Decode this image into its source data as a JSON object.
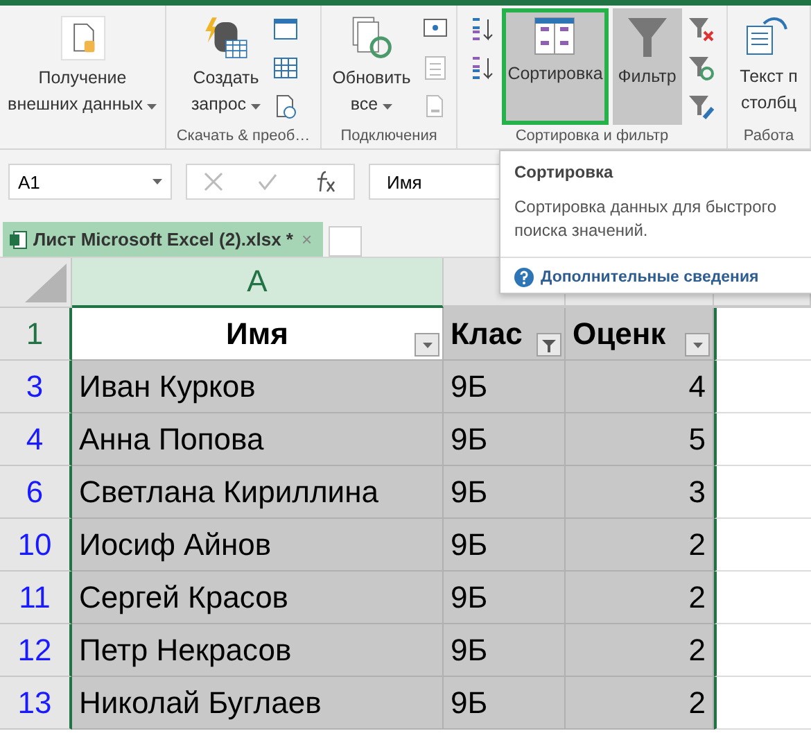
{
  "ribbon": {
    "groups": [
      {
        "buttons": [
          {
            "lines": [
              "Получение",
              "внешних данных"
            ],
            "has_menu": true,
            "selected": false,
            "pressed": false
          }
        ]
      },
      {
        "label": "Скачать & преоб…",
        "buttons": [
          {
            "lines": [
              "Создать",
              "запрос"
            ],
            "has_menu": true,
            "selected": false,
            "pressed": false
          }
        ]
      },
      {
        "label": "Подключения",
        "buttons": [
          {
            "lines": [
              "Обновить",
              "все"
            ],
            "has_menu": true,
            "selected": false,
            "pressed": false
          }
        ]
      },
      {
        "label": "Сортировка и фильтр",
        "buttons": [
          {
            "lines": [
              "Сортировка"
            ],
            "has_menu": false,
            "selected": true,
            "pressed": true
          },
          {
            "lines": [
              "Фильтр"
            ],
            "has_menu": false,
            "selected": false,
            "pressed": true
          }
        ]
      },
      {
        "label": "Работа",
        "buttons": [
          {
            "lines": [
              "Текст п",
              "столбц"
            ],
            "has_menu": false,
            "selected": false,
            "pressed": false
          }
        ]
      }
    ]
  },
  "formula_bar": {
    "name_box": "A1",
    "value": "Имя"
  },
  "workbook_tab": {
    "label": "Лист Microsoft Excel (2).xlsx *",
    "close": "×"
  },
  "tooltip": {
    "title": "Сортировка",
    "description": "Сортировка данных для быстрого поиска значений.",
    "link": "Дополнительные сведения"
  },
  "sheet": {
    "columns": [
      "A"
    ],
    "header_row": {
      "number": "1",
      "cells": [
        {
          "text": "Имя",
          "filter_applied": false,
          "active": true
        },
        {
          "text": "Клас",
          "filter_applied": true,
          "active": false
        },
        {
          "text": "Оценк",
          "filter_applied": false,
          "active": false
        }
      ]
    },
    "rows": [
      {
        "number": "3",
        "filtered": true,
        "cells": [
          "Иван Курков",
          "9Б",
          "4"
        ]
      },
      {
        "number": "4",
        "filtered": true,
        "cells": [
          "Анна Попова",
          "9Б",
          "5"
        ]
      },
      {
        "number": "6",
        "filtered": true,
        "cells": [
          "Светлана Кириллина",
          "9Б",
          "3"
        ]
      },
      {
        "number": "10",
        "filtered": true,
        "cells": [
          "Иосиф Айнов",
          "9Б",
          "2"
        ]
      },
      {
        "number": "11",
        "filtered": true,
        "cells": [
          "Сергей Красов",
          "9Б",
          "2"
        ]
      },
      {
        "number": "12",
        "filtered": true,
        "cells": [
          "Петр Некрасов",
          "9Б",
          "2"
        ]
      },
      {
        "number": "13",
        "filtered": true,
        "cells": [
          "Николай Буглаев",
          "9Б",
          "2"
        ]
      }
    ]
  }
}
